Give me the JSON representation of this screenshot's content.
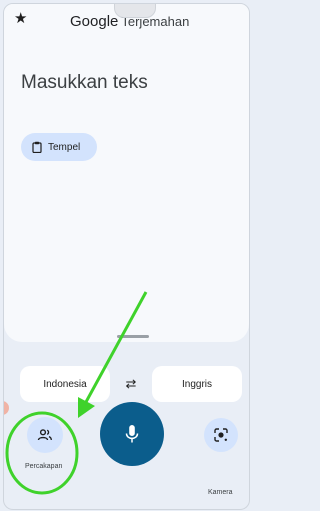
{
  "app": {
    "title_brand": "Google",
    "title_product": "Terjemahan",
    "favorite_icon": "star-icon"
  },
  "input": {
    "placeholder": "Masukkan teks"
  },
  "paste": {
    "label": "Tempel",
    "icon": "clipboard-icon"
  },
  "languages": {
    "source": "Indonesia",
    "target": "Inggris",
    "swap_icon": "swap-arrows-icon"
  },
  "actions": {
    "conversation_label": "Percakapan",
    "conversation_icon": "people-icon",
    "mic_icon": "microphone-icon",
    "camera_label": "Kamera",
    "camera_icon": "lens-camera-icon"
  },
  "colors": {
    "accent_light": "#d3e3fd",
    "mic_bg": "#0b5d8c",
    "annotation_green": "#3fd22b"
  }
}
